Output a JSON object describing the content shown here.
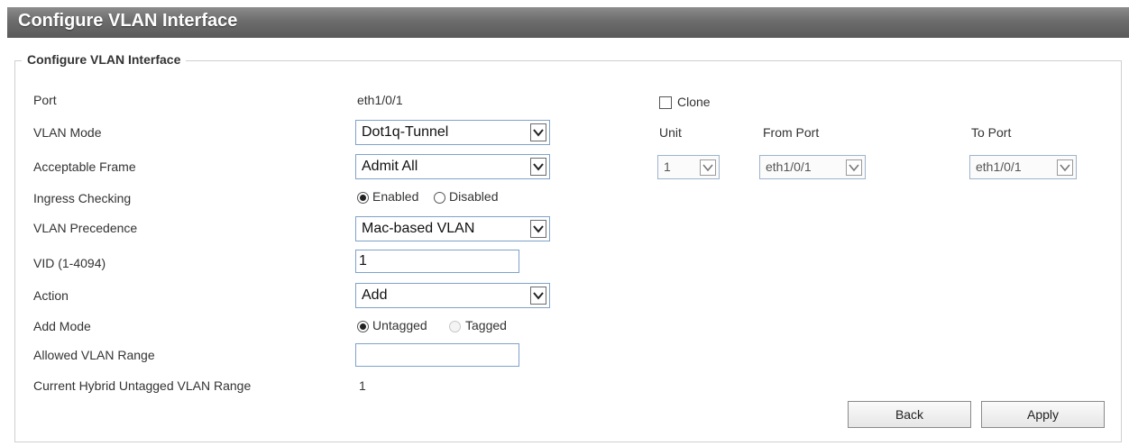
{
  "page": {
    "title": "Configure VLAN Interface"
  },
  "panel": {
    "legend": "Configure VLAN Interface"
  },
  "form": {
    "port_label": "Port",
    "port_value": "eth1/0/1",
    "clone_label": "Clone",
    "vlan_mode_label": "VLAN Mode",
    "vlan_mode_value": "Dot1q-Tunnel",
    "acceptable_frame_label": "Acceptable Frame",
    "acceptable_frame_value": "Admit All",
    "ingress_checking_label": "Ingress Checking",
    "ingress_enabled_label": "Enabled",
    "ingress_disabled_label": "Disabled",
    "vlan_precedence_label": "VLAN Precedence",
    "vlan_precedence_value": "Mac-based VLAN",
    "vid_label": "VID (1-4094)",
    "vid_value": "1",
    "action_label": "Action",
    "action_value": "Add",
    "add_mode_label": "Add Mode",
    "add_mode_untagged_label": "Untagged",
    "add_mode_tagged_label": "Tagged",
    "allowed_vlan_range_label": "Allowed VLAN Range",
    "allowed_vlan_range_value": "",
    "current_hybrid_label": "Current Hybrid Untagged VLAN Range",
    "current_hybrid_value": "1"
  },
  "clone": {
    "unit_label": "Unit",
    "unit_value": "1",
    "from_port_label": "From Port",
    "from_port_value": "eth1/0/1",
    "to_port_label": "To Port",
    "to_port_value": "eth1/0/1"
  },
  "buttons": {
    "back": "Back",
    "apply": "Apply"
  },
  "icons": {
    "dropdown": "chevron-down-icon"
  }
}
